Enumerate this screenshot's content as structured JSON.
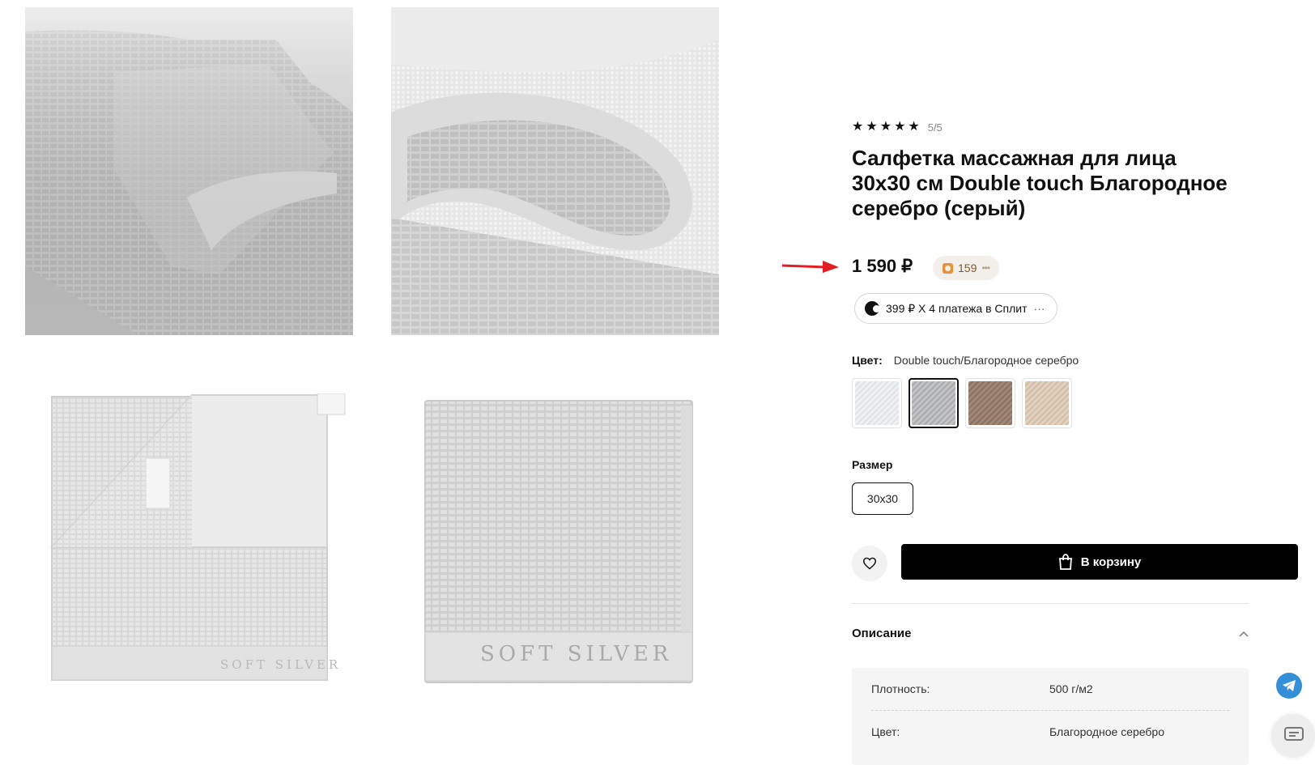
{
  "gallery": {
    "photo3_label": "SOFT SILVER",
    "photo4_label": "SOFT SILVER"
  },
  "product": {
    "rating_stars": 5,
    "rating_text": "5/5",
    "title": "Салфетка массажная для лица 30х30 см Double touch Благородное серебро (серый)",
    "price": "1 590 ₽",
    "bonus_points": "159",
    "split_text": "399 ₽ Х 4 платежа в Сплит",
    "split_more": "···"
  },
  "color": {
    "label": "Цвет:",
    "value": "Double touch/Благородное серебро",
    "swatches": [
      {
        "name": "white",
        "color": "#eceef0",
        "selected": false
      },
      {
        "name": "silver",
        "color": "#b7b8ba",
        "selected": true
      },
      {
        "name": "brown",
        "color": "#9a8070",
        "selected": false
      },
      {
        "name": "beige",
        "color": "#ddcab6",
        "selected": false
      }
    ]
  },
  "size": {
    "label": "Размер",
    "options": [
      "30x30"
    ]
  },
  "actions": {
    "cart_label": "В корзину"
  },
  "description": {
    "title": "Описание",
    "properties": [
      {
        "name": "Плотность:",
        "value": "500 г/м2"
      },
      {
        "name": "Цвет:",
        "value": "Благородное серебро"
      }
    ]
  },
  "colors": {
    "accent": "#000000",
    "arrow": "#e31e24",
    "telegram": "#3390d8"
  }
}
